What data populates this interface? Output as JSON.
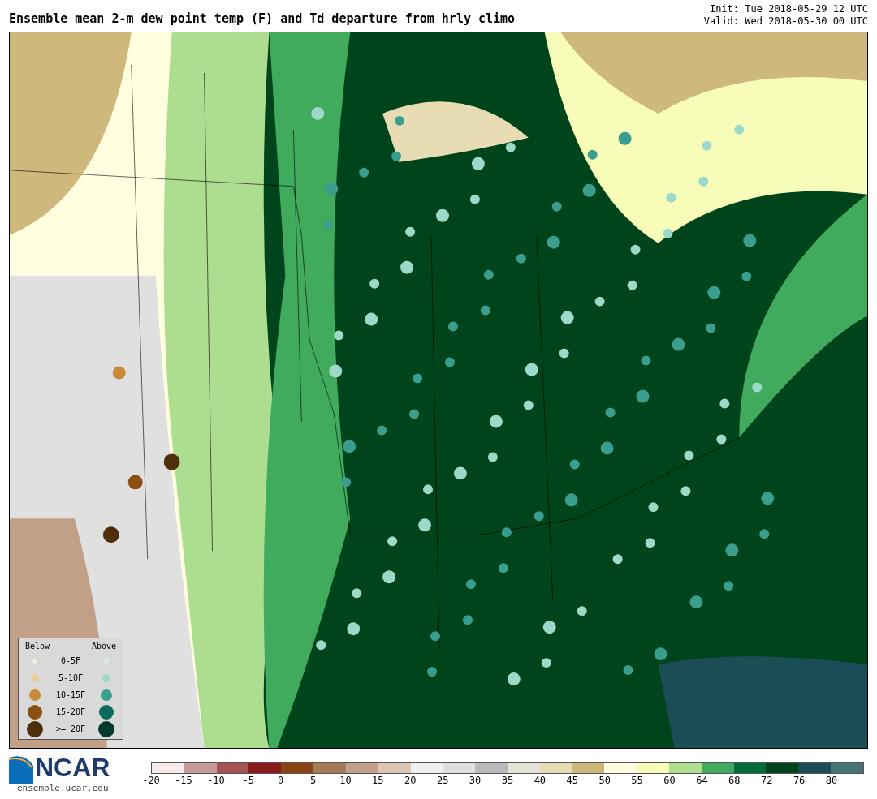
{
  "title": "Ensemble mean 2-m dew point temp (F) and Td departure from hrly climo",
  "init": "Init: Tue 2018-05-29 12 UTC",
  "valid": "Valid: Wed 2018-05-30 00 UTC",
  "legend": {
    "below_label": "Below",
    "above_label": "Above",
    "rows": [
      {
        "label": "0-5F",
        "below": {
          "color": "#f3efd9"
        },
        "above": {
          "color": "#d6efe6"
        }
      },
      {
        "label": "5-10F",
        "below": {
          "color": "#e8cf97"
        },
        "above": {
          "color": "#9dd9c8"
        }
      },
      {
        "label": "10-15F",
        "below": {
          "color": "#c98a3a"
        },
        "above": {
          "color": "#3a9e8e"
        }
      },
      {
        "label": "15-20F",
        "below": {
          "color": "#8b5010"
        },
        "above": {
          "color": "#0a6b5e"
        }
      },
      {
        "label": ">= 20F",
        "below": {
          "color": "#4f2e0a"
        },
        "above": {
          "color": "#03392f"
        }
      }
    ]
  },
  "logo": {
    "name": "NCAR",
    "url": "ensemble.ucar.edu"
  },
  "colorbar": [
    {
      "label": "-20",
      "color": "#f5e9e9"
    },
    {
      "label": "-15",
      "color": "#c99a9a"
    },
    {
      "label": "-10",
      "color": "#a85353"
    },
    {
      "label": "-5",
      "color": "#8b1a1a"
    },
    {
      "label": "0",
      "color": "#8b4513"
    },
    {
      "label": "5",
      "color": "#a67a56"
    },
    {
      "label": "10",
      "color": "#c2a088"
    },
    {
      "label": "15",
      "color": "#dcc5b4"
    },
    {
      "label": "20",
      "color": "#f0f0f0"
    },
    {
      "label": "25",
      "color": "#e0e0e0"
    },
    {
      "label": "30",
      "color": "#bbbbbb"
    },
    {
      "label": "35",
      "color": "#e4e4d8"
    },
    {
      "label": "40",
      "color": "#e8dcb5"
    },
    {
      "label": "45",
      "color": "#cfb87c"
    },
    {
      "label": "50",
      "color": "#ffffe0"
    },
    {
      "label": "55",
      "color": "#f7fcb9"
    },
    {
      "label": "60",
      "color": "#addd8e"
    },
    {
      "label": "64",
      "color": "#41ab5d"
    },
    {
      "label": "68",
      "color": "#006d39"
    },
    {
      "label": "72",
      "color": "#00441b"
    },
    {
      "label": "76",
      "color": "#1a4d55"
    },
    {
      "label": "80",
      "color": "#457575"
    }
  ]
}
